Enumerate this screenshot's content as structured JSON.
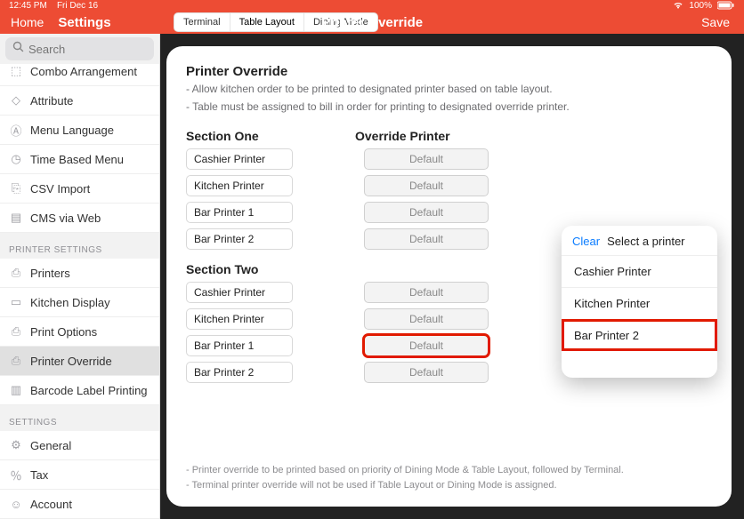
{
  "status": {
    "time": "12:45 PM",
    "date": "Fri Dec 16",
    "battery": "100%"
  },
  "nav": {
    "home": "Home",
    "settings": "Settings",
    "save": "Save",
    "title": "Printer Override",
    "segments": {
      "terminal": "Terminal",
      "table": "Table Layout",
      "dining": "Dining Mode"
    }
  },
  "search": {
    "placeholder": "Search"
  },
  "sidebar": {
    "items_top": [
      {
        "label": "Combo Arrangement"
      },
      {
        "label": "Attribute"
      },
      {
        "label": "Menu Language"
      },
      {
        "label": "Time Based Menu"
      },
      {
        "label": "CSV Import"
      },
      {
        "label": "CMS via Web"
      }
    ],
    "printer_header": "PRINTER SETTINGS",
    "printer_items": [
      {
        "label": "Printers"
      },
      {
        "label": "Kitchen Display"
      },
      {
        "label": "Print Options"
      },
      {
        "label": "Printer Override"
      },
      {
        "label": "Barcode Label Printing"
      }
    ],
    "settings_header": "SETTINGS",
    "settings_items": [
      {
        "label": "General"
      },
      {
        "label": "Tax"
      },
      {
        "label": "Account"
      }
    ]
  },
  "main": {
    "heading": "Printer Override",
    "desc1": " - Allow kitchen order to be printed to designated printer based on table layout.",
    "desc2": " - Table must be assigned to bill in order for printing to designated override printer.",
    "col_override": "Override Printer",
    "sections": [
      {
        "name": "Section One",
        "rows": [
          {
            "printer": "Cashier Printer",
            "override": "Default"
          },
          {
            "printer": "Kitchen Printer",
            "override": "Default"
          },
          {
            "printer": "Bar Printer 1",
            "override": "Default"
          },
          {
            "printer": "Bar Printer 2",
            "override": "Default"
          }
        ]
      },
      {
        "name": "Section Two",
        "rows": [
          {
            "printer": "Cashier Printer",
            "override": "Default"
          },
          {
            "printer": "Kitchen Printer",
            "override": "Default"
          },
          {
            "printer": "Bar Printer 1",
            "override": "Default"
          },
          {
            "printer": "Bar Printer 2",
            "override": "Default"
          }
        ]
      }
    ],
    "foot1": " - Printer override to be printed based on priority of Dining Mode & Table Layout, followed by Terminal.",
    "foot2": " - Terminal printer override will not be used if Table Layout or Dining Mode is assigned."
  },
  "popover": {
    "clear": "Clear",
    "title": "Select a printer",
    "items": [
      {
        "label": "Cashier Printer"
      },
      {
        "label": "Kitchen Printer"
      },
      {
        "label": "Bar Printer 2"
      }
    ]
  }
}
